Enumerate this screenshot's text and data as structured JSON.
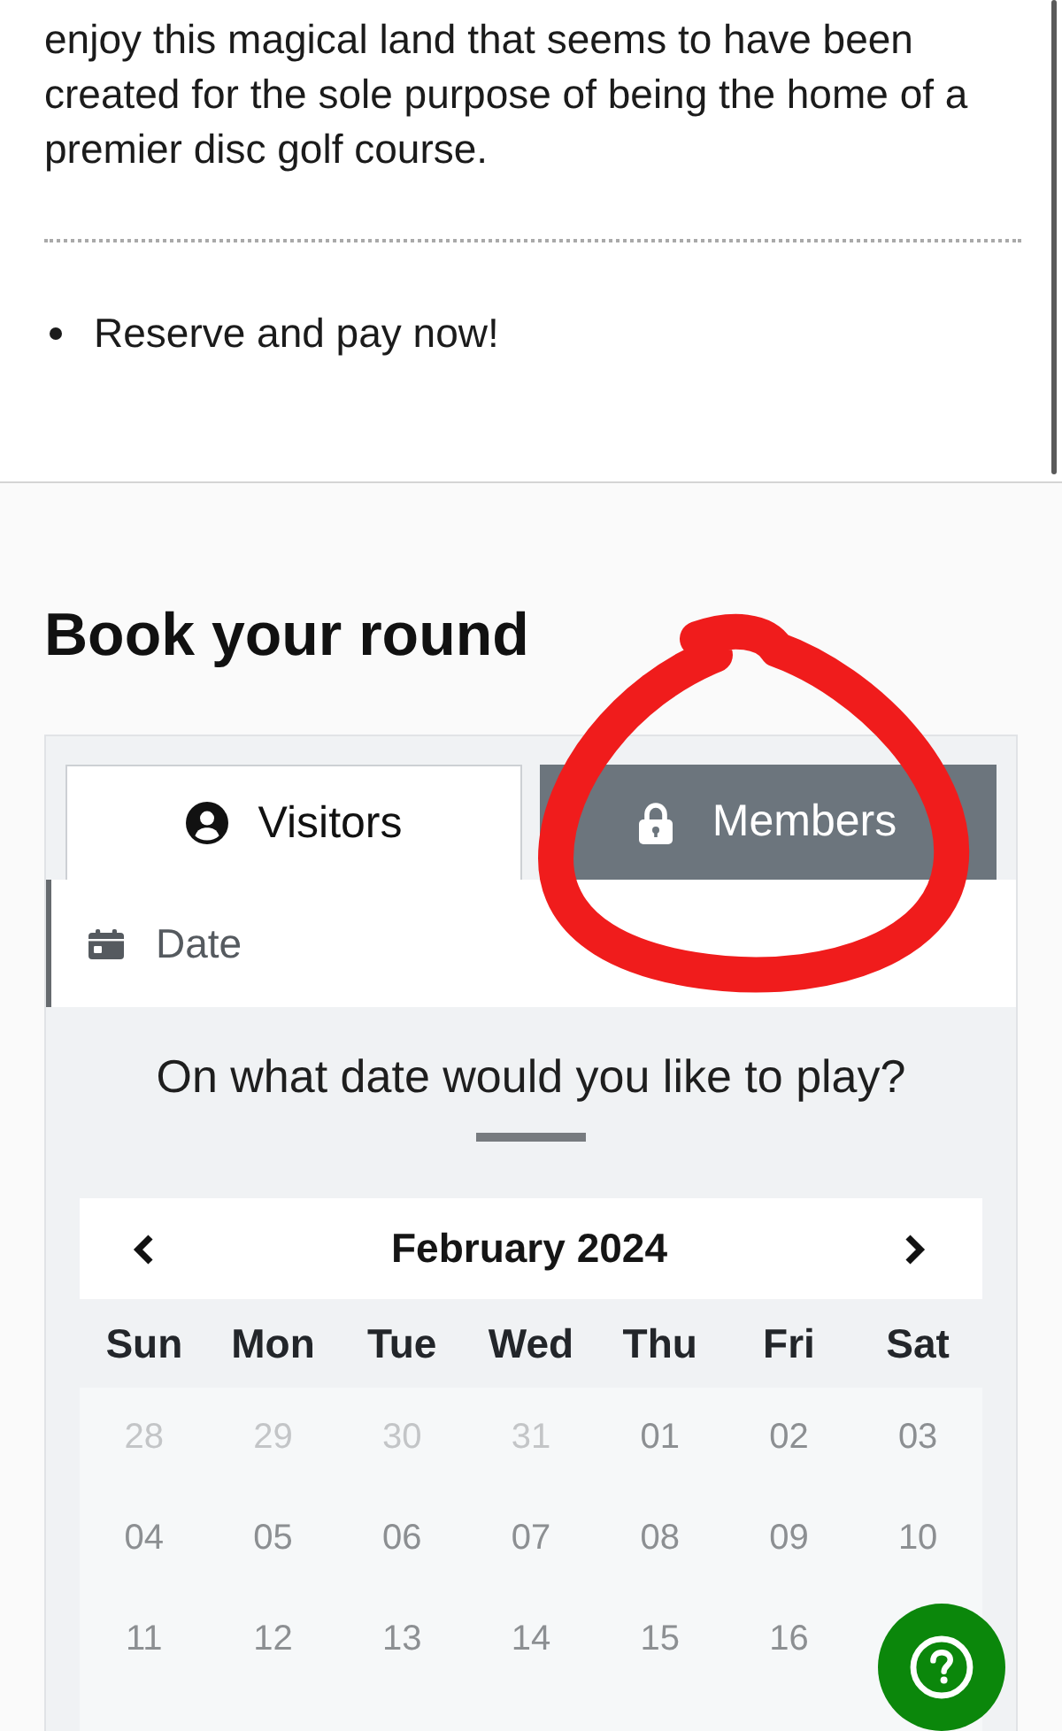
{
  "intro": {
    "paragraph": "enjoy this magical land that seems to have been created for the sole purpose of being the home of a premier disc golf course.",
    "bullets": [
      "Reserve and pay now!"
    ]
  },
  "booking": {
    "heading": "Book your round",
    "tabs": [
      {
        "label": "Visitors",
        "selected": true,
        "locked": false,
        "circled": false
      },
      {
        "label": "Members",
        "selected": false,
        "locked": true,
        "circled": true
      }
    ],
    "step": {
      "label": "Date"
    },
    "question": "On what date would you like to play?",
    "calendar": {
      "month": "February 2024",
      "weekdays": [
        "Sun",
        "Mon",
        "Tue",
        "Wed",
        "Thu",
        "Fri",
        "Sat"
      ],
      "weeks": [
        [
          {
            "day": "28",
            "muted": true
          },
          {
            "day": "29",
            "muted": true
          },
          {
            "day": "30",
            "muted": true
          },
          {
            "day": "31",
            "muted": true
          },
          {
            "day": "01",
            "muted": false
          },
          {
            "day": "02",
            "muted": false
          },
          {
            "day": "03",
            "muted": false
          }
        ],
        [
          {
            "day": "04",
            "muted": false
          },
          {
            "day": "05",
            "muted": false
          },
          {
            "day": "06",
            "muted": false
          },
          {
            "day": "07",
            "muted": false
          },
          {
            "day": "08",
            "muted": false
          },
          {
            "day": "09",
            "muted": false
          },
          {
            "day": "10",
            "muted": false
          }
        ],
        [
          {
            "day": "11",
            "muted": false
          },
          {
            "day": "12",
            "muted": false
          },
          {
            "day": "13",
            "muted": false
          },
          {
            "day": "14",
            "muted": false
          },
          {
            "day": "15",
            "muted": false
          },
          {
            "day": "16",
            "muted": false
          }
        ]
      ]
    }
  }
}
